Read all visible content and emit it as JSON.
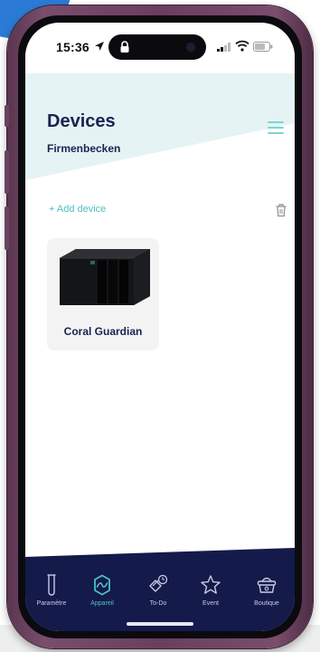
{
  "status_bar": {
    "time": "15:36"
  },
  "header": {
    "title": "Devices",
    "subtitle": "Firmenbecken"
  },
  "actions": {
    "add_device": "+ Add device"
  },
  "devices": [
    {
      "name": "Coral Guardian"
    }
  ],
  "tabs": [
    {
      "label": "Paramètre",
      "icon": "test-tube-icon"
    },
    {
      "label": "Appareil",
      "icon": "device-icon",
      "active": true
    },
    {
      "label": "To-Do",
      "icon": "todo-icon"
    },
    {
      "label": "Event",
      "icon": "star-icon"
    },
    {
      "label": "Boutique",
      "icon": "shopping-basket-icon"
    }
  ],
  "colors": {
    "navy": "#1b2250",
    "accent_teal": "#4fbfbd",
    "tabbar_bg": "#141a4a",
    "header_tint": "#e5f3f4"
  }
}
